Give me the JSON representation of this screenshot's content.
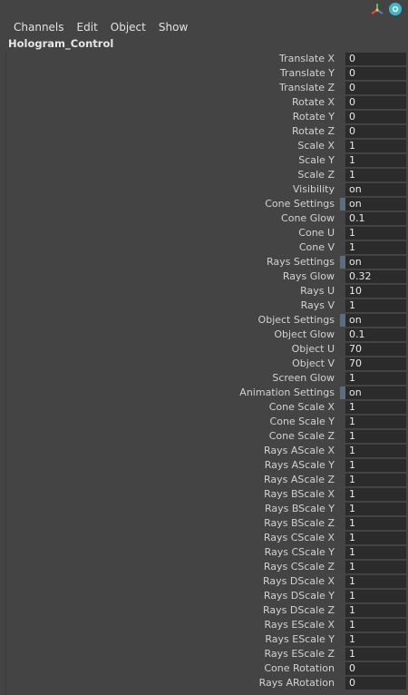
{
  "menus": [
    "Channels",
    "Edit",
    "Object",
    "Show"
  ],
  "node_name": "Hologram_Control",
  "attributes": [
    {
      "label": "Translate X",
      "value": "0"
    },
    {
      "label": "Translate Y",
      "value": "0"
    },
    {
      "label": "Translate Z",
      "value": "0"
    },
    {
      "label": "Rotate X",
      "value": "0"
    },
    {
      "label": "Rotate Y",
      "value": "0"
    },
    {
      "label": "Rotate Z",
      "value": "0"
    },
    {
      "label": "Scale X",
      "value": "1"
    },
    {
      "label": "Scale Y",
      "value": "1"
    },
    {
      "label": "Scale Z",
      "value": "1"
    },
    {
      "label": "Visibility",
      "value": "on"
    },
    {
      "label": "Cone Settings",
      "value": "on",
      "marker": true
    },
    {
      "label": "Cone Glow",
      "value": "0.1"
    },
    {
      "label": "Cone U",
      "value": "1"
    },
    {
      "label": "Cone V",
      "value": "1"
    },
    {
      "label": "Rays Settings",
      "value": "on",
      "marker": true
    },
    {
      "label": "Rays Glow",
      "value": "0.32"
    },
    {
      "label": "Rays U",
      "value": "10"
    },
    {
      "label": "Rays V",
      "value": "1"
    },
    {
      "label": "Object Settings",
      "value": "on",
      "marker": true
    },
    {
      "label": "Object Glow",
      "value": "0.1"
    },
    {
      "label": "Object U",
      "value": "70"
    },
    {
      "label": "Object V",
      "value": "70"
    },
    {
      "label": "Screen Glow",
      "value": "1"
    },
    {
      "label": "Animation Settings",
      "value": "on",
      "marker": true
    },
    {
      "label": "Cone Scale X",
      "value": "1"
    },
    {
      "label": "Cone Scale Y",
      "value": "1"
    },
    {
      "label": "Cone Scale Z",
      "value": "1"
    },
    {
      "label": "Rays AScale X",
      "value": "1"
    },
    {
      "label": "Rays AScale Y",
      "value": "1"
    },
    {
      "label": "Rays AScale Z",
      "value": "1"
    },
    {
      "label": "Rays BScale X",
      "value": "1"
    },
    {
      "label": "Rays BScale Y",
      "value": "1"
    },
    {
      "label": "Rays BScale Z",
      "value": "1"
    },
    {
      "label": "Rays CScale X",
      "value": "1"
    },
    {
      "label": "Rays CScale Y",
      "value": "1"
    },
    {
      "label": "Rays CScale Z",
      "value": "1"
    },
    {
      "label": "Rays DScale X",
      "value": "1"
    },
    {
      "label": "Rays DScale Y",
      "value": "1"
    },
    {
      "label": "Rays DScale Z",
      "value": "1"
    },
    {
      "label": "Rays EScale X",
      "value": "1"
    },
    {
      "label": "Rays EScale Y",
      "value": "1"
    },
    {
      "label": "Rays EScale Z",
      "value": "1"
    },
    {
      "label": "Cone Rotation",
      "value": "0"
    },
    {
      "label": "Rays ARotation",
      "value": "0"
    }
  ],
  "colors": {
    "background": "#444444",
    "field": "#2b2b2b",
    "marker": "#5d6d80"
  },
  "icons": [
    "axis-gizmo-icon",
    "help-globe-icon"
  ]
}
